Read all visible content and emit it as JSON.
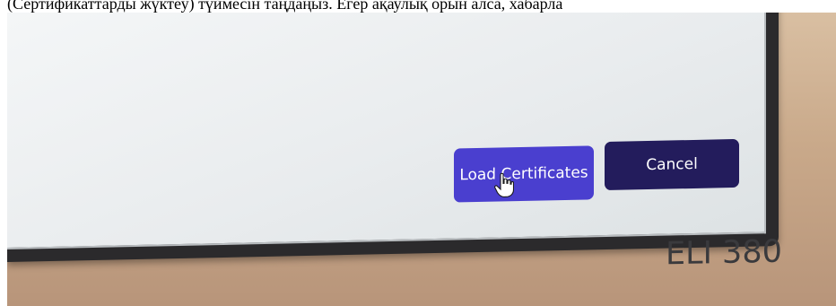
{
  "caption": {
    "text": "(Сертификаттарды жүктеу) түймесін таңдаңыз. Егер ақаулық орын алса, хабарла"
  },
  "dialog": {
    "load_certificates_label": "Load Certificates",
    "cancel_label": "Cancel"
  },
  "device": {
    "model": "ELI 380"
  },
  "colors": {
    "load_button": "#4a3fcf",
    "cancel_button": "#231c5c",
    "screen": "#e9ecee",
    "bezel": "#2b2a2c",
    "casing": "#c9a98a"
  }
}
